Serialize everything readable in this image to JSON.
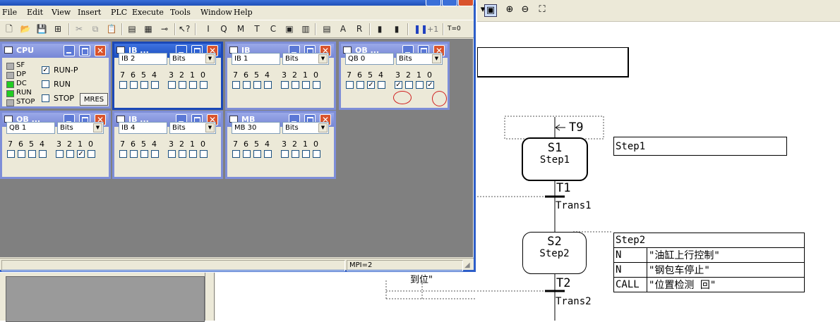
{
  "menu": [
    "File",
    "Edit",
    "View",
    "Insert",
    "PLC",
    "Execute",
    "Tools",
    "Window",
    "Help"
  ],
  "toolbar": {
    "plus_one": "+1",
    "t0": "T=0"
  },
  "status": {
    "mpi": "MPI=2"
  },
  "cpu_window": {
    "title": "CPU",
    "leds": [
      {
        "label": "SF",
        "on": false
      },
      {
        "label": "DP",
        "on": false
      },
      {
        "label": "DC",
        "on": true
      },
      {
        "label": "RUN",
        "on": true
      },
      {
        "label": "STOP",
        "on": false
      }
    ],
    "modes": [
      {
        "label": "RUN-P",
        "checked": true
      },
      {
        "label": "RUN",
        "checked": false
      },
      {
        "label": "STOP",
        "checked": false
      }
    ],
    "mres": "MRES"
  },
  "bit_labels": [
    "7",
    "6",
    "5",
    "4",
    "3",
    "2",
    "1",
    "0"
  ],
  "io_windows": [
    {
      "title": "IB     ...",
      "area": "IB",
      "addr": "2",
      "format": "Bits",
      "active": true,
      "bits": [
        0,
        0,
        0,
        0,
        0,
        0,
        0,
        0
      ]
    },
    {
      "title": "IB",
      "area": "IB",
      "addr": "1",
      "format": "Bits",
      "active": false,
      "bits": [
        0,
        0,
        0,
        0,
        0,
        0,
        0,
        0
      ]
    },
    {
      "title": "QB     ...",
      "area": "QB",
      "addr": "0",
      "format": "Bits",
      "active": false,
      "bits": [
        0,
        0,
        1,
        0,
        1,
        0,
        0,
        1
      ]
    },
    {
      "title": "QB     ...",
      "area": "QB",
      "addr": "1",
      "format": "Bits",
      "active": false,
      "bits": [
        0,
        0,
        0,
        0,
        0,
        0,
        1,
        0
      ]
    },
    {
      "title": "IB     ...",
      "area": "IB",
      "addr": "4",
      "format": "Bits",
      "active": false,
      "bits": [
        0,
        0,
        0,
        0,
        0,
        0,
        0,
        0
      ]
    },
    {
      "title": "MB",
      "area": "MB",
      "addr": "30",
      "format": "Bits",
      "active": false,
      "bits": [
        0,
        0,
        0,
        0,
        0,
        0,
        0,
        0
      ]
    }
  ],
  "sfc": {
    "t9": "T9",
    "s1": {
      "name": "S1",
      "label": "Step1"
    },
    "s1_comment": "Step1",
    "t1": {
      "name": "T1",
      "label": "Trans1"
    },
    "s2": {
      "name": "S2",
      "label": "Step2"
    },
    "s2_table": {
      "header": "Step2",
      "rows": [
        {
          "q": "N",
          "action": "\"油缸上行控制\""
        },
        {
          "q": "N",
          "action": "\"钢包车停止\""
        },
        {
          "q": "CALL",
          "action": "\"位置检测   回\""
        }
      ]
    },
    "t2": {
      "name": "T2",
      "label": "Trans2"
    },
    "partial_text": "到位\""
  }
}
